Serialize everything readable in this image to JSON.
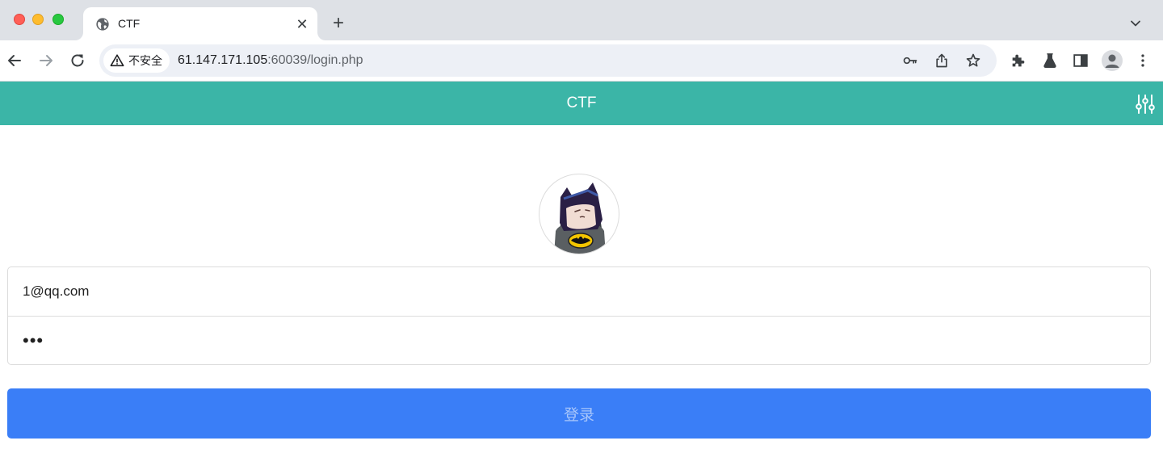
{
  "browser": {
    "tab": {
      "title": "CTF",
      "close_glyph": "✕",
      "icon": "globe-icon"
    },
    "new_tab_glyph": "+",
    "omnibox": {
      "security_label": "不安全",
      "url_host": "61.147.171.105",
      "url_rest": ":60039/login.php"
    },
    "toolbar_icons": [
      "back-icon",
      "forward-icon",
      "reload-icon",
      "key-icon",
      "share-icon",
      "star-icon",
      "extensions-icon",
      "labs-flask-icon",
      "side-panel-icon",
      "profile-icon",
      "more-menu-icon"
    ]
  },
  "app": {
    "title": "CTF",
    "header_color": "#3bb5a7",
    "settings_icon": "sliders-icon"
  },
  "login": {
    "email_value": "1@qq.com",
    "password_value": "123",
    "submit_label": "登录",
    "submit_color": "#3a7ef7"
  }
}
